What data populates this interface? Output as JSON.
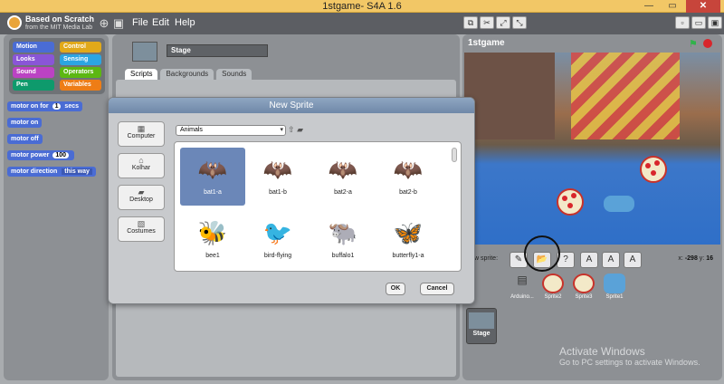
{
  "window": {
    "title": "1stgame- S4A 1.6"
  },
  "logo": {
    "line1": "Based on Scratch",
    "line2": "from the MIT Media Lab"
  },
  "menu": {
    "file": "File",
    "edit": "Edit",
    "help": "Help"
  },
  "categories": [
    {
      "label": "Motion",
      "color": "#4a6cd4"
    },
    {
      "label": "Control",
      "color": "#e1a91a"
    },
    {
      "label": "Looks",
      "color": "#8a55d7"
    },
    {
      "label": "Sensing",
      "color": "#2ca5e2"
    },
    {
      "label": "Sound",
      "color": "#bb42c3"
    },
    {
      "label": "Operators",
      "color": "#5cb712"
    },
    {
      "label": "Pen",
      "color": "#0e9a6c"
    },
    {
      "label": "Variables",
      "color": "#ee7d16"
    }
  ],
  "blocks": {
    "motor_on_for": "motor on for",
    "motor_on_for_value": "1",
    "motor_on_for_unit": "secs",
    "motor_on": "motor on",
    "motor_off": "motor off",
    "motor_power": "motor power",
    "motor_power_value": "100",
    "motor_direction": "motor direction",
    "motor_direction_value": "this way"
  },
  "sprite_header": {
    "name": "Stage"
  },
  "tabs": {
    "scripts": "Scripts",
    "backgrounds": "Backgrounds",
    "sounds": "Sounds"
  },
  "stage": {
    "project_name": "1stgame",
    "new_sprite_label": "New sprite:",
    "x_label": "x:",
    "x_value": "-298",
    "y_label": "y:",
    "y_value": "16"
  },
  "sprites": [
    {
      "name": "Arduino..."
    },
    {
      "name": "Sprite2"
    },
    {
      "name": "Sprite3"
    },
    {
      "name": "Sprite1"
    }
  ],
  "stage_thumb": {
    "label": "Stage"
  },
  "watermark": {
    "line1": "Activate Windows",
    "line2": "Go to PC settings to activate Windows."
  },
  "dialog": {
    "title": "New Sprite",
    "places": [
      {
        "label": "Computer",
        "icon": "computer-icon"
      },
      {
        "label": "Kolhar",
        "icon": "home-icon"
      },
      {
        "label": "Desktop",
        "icon": "folder-icon"
      },
      {
        "label": "Costumes",
        "icon": "costumes-icon"
      }
    ],
    "folder": "Animals",
    "files": [
      {
        "label": "bat1-a",
        "glyph": "🦇",
        "selected": true
      },
      {
        "label": "bat1-b",
        "glyph": "🦇"
      },
      {
        "label": "bat2-a",
        "glyph": "🦇"
      },
      {
        "label": "bat2-b",
        "glyph": "🦇"
      },
      {
        "label": "bee1",
        "glyph": "🐝"
      },
      {
        "label": "bird-flying",
        "glyph": "🐦"
      },
      {
        "label": "buffalo1",
        "glyph": "🐃"
      },
      {
        "label": "butterfly1-a",
        "glyph": "🦋"
      }
    ],
    "ok": "OK",
    "cancel": "Cancel"
  }
}
